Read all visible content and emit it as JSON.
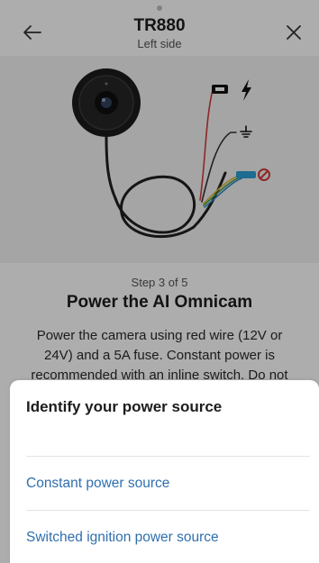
{
  "header": {
    "title": "TR880",
    "subtitle": "Left side"
  },
  "icons": {
    "back": "arrow-left-icon",
    "close": "close-icon",
    "lightning": "lightning-icon",
    "ground": "ground-icon",
    "prohibited": "prohibited-icon"
  },
  "step": {
    "counter": "Step 3 of 5",
    "heading": "Power the AI Omnicam",
    "description": "Power the camera using red wire (12V or 24V) and a 5A fuse. Constant power is recommended with an inline switch. Do not use blue wrapped wires. If the camera"
  },
  "sheet": {
    "title": "Identify your power source",
    "options": [
      {
        "label": "Constant power source"
      },
      {
        "label": "Switched ignition power source"
      }
    ]
  },
  "colors": {
    "link": "#2f6fae",
    "red_wire": "#d33a3a",
    "illustration_bg": "#f3f3f3"
  }
}
